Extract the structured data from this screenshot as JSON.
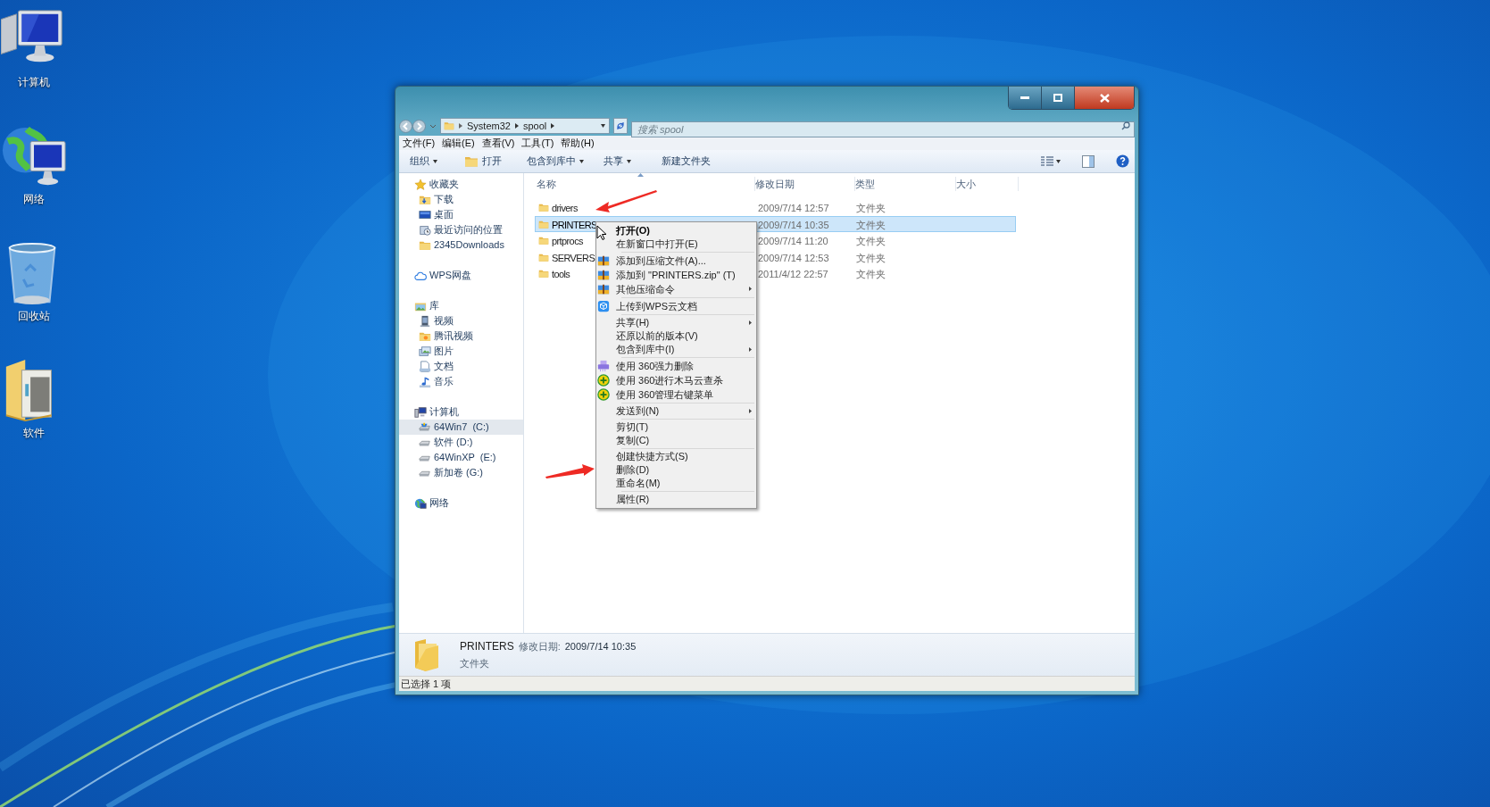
{
  "desktop": {
    "icons": [
      {
        "label": "计算机"
      },
      {
        "label": "网络"
      },
      {
        "label": "回收站"
      },
      {
        "label": "软件"
      }
    ]
  },
  "window": {
    "address": {
      "segments": [
        "System32",
        "spool"
      ]
    },
    "search": {
      "placeholder": "搜索 spool"
    },
    "menu_bar": [
      "文件(F)",
      "编辑(E)",
      "查看(V)",
      "工具(T)",
      "帮助(H)"
    ],
    "toolbar": [
      {
        "label": "组织",
        "dropdown": true
      },
      {
        "label": "打开",
        "dropdown": false
      },
      {
        "label": "包含到库中",
        "dropdown": true
      },
      {
        "label": "共享",
        "dropdown": true
      },
      {
        "label": "新建文件夹",
        "dropdown": false
      }
    ],
    "sidebar": [
      {
        "label": "收藏夹",
        "selected": false,
        "children": [
          {
            "label": "下载",
            "selected": false
          },
          {
            "label": "桌面",
            "selected": false
          },
          {
            "label": "最近访问的位置",
            "selected": false
          },
          {
            "label": "2345Downloads",
            "selected": false
          }
        ]
      },
      {
        "label": "WPS网盘",
        "selected": false
      },
      {
        "label": "库",
        "selected": false,
        "children": [
          {
            "label": "视频",
            "selected": false
          },
          {
            "label": "腾讯视频",
            "selected": false
          },
          {
            "label": "图片",
            "selected": false
          },
          {
            "label": "文档",
            "selected": false
          },
          {
            "label": "音乐",
            "selected": false
          }
        ]
      },
      {
        "label": "计算机",
        "selected": false,
        "children": [
          {
            "label": "64Win7  (C:)",
            "selected": true
          },
          {
            "label": "软件 (D:)",
            "selected": false
          },
          {
            "label": "64WinXP  (E:)",
            "selected": false
          },
          {
            "label": "新加卷 (G:)",
            "selected": false
          }
        ]
      },
      {
        "label": "网络",
        "selected": false
      }
    ],
    "files": {
      "columns": [
        "名称",
        "修改日期",
        "类型",
        "大小"
      ],
      "rows": [
        {
          "name": "drivers",
          "date": "2009/7/14 12:57",
          "type": "文件夹",
          "selected": false
        },
        {
          "name": "PRINTERS",
          "date": "2009/7/14 10:35",
          "type": "文件夹",
          "selected": true
        },
        {
          "name": "prtprocs",
          "date": "2009/7/14 11:20",
          "type": "文件夹",
          "selected": false
        },
        {
          "name": "SERVERS",
          "date": "2009/7/14 12:53",
          "type": "文件夹",
          "selected": false
        },
        {
          "name": "tools",
          "date": "2011/4/12 22:57",
          "type": "文件夹",
          "selected": false
        }
      ]
    },
    "context_menu": {
      "groups": [
        [
          {
            "label": "打开(O)",
            "default": true,
            "submenu": false
          },
          {
            "label": "在新窗口中打开(E)",
            "default": false,
            "submenu": false
          }
        ],
        [
          {
            "label": "添加到压缩文件(A)...",
            "default": false,
            "submenu": false
          },
          {
            "label": "添加到 \"PRINTERS.zip\" (T)",
            "default": false,
            "submenu": false
          },
          {
            "label": "其他压缩命令",
            "default": false,
            "submenu": true
          }
        ],
        [
          {
            "label": "上传到WPS云文档",
            "default": false,
            "submenu": false
          }
        ],
        [
          {
            "label": "共享(H)",
            "default": false,
            "submenu": true
          },
          {
            "label": "还原以前的版本(V)",
            "default": false,
            "submenu": false
          },
          {
            "label": "包含到库中(I)",
            "default": false,
            "submenu": true
          }
        ],
        [
          {
            "label": "使用 360强力删除",
            "default": false,
            "submenu": false
          },
          {
            "label": "使用 360进行木马云查杀",
            "default": false,
            "submenu": false
          },
          {
            "label": "使用 360管理右键菜单",
            "default": false,
            "submenu": false
          }
        ],
        [
          {
            "label": "发送到(N)",
            "default": false,
            "submenu": true
          }
        ],
        [
          {
            "label": "剪切(T)",
            "default": false,
            "submenu": false
          },
          {
            "label": "复制(C)",
            "default": false,
            "submenu": false
          }
        ],
        [
          {
            "label": "创建快捷方式(S)",
            "default": false,
            "submenu": false
          },
          {
            "label": "删除(D)",
            "default": false,
            "submenu": false
          },
          {
            "label": "重命名(M)",
            "default": false,
            "submenu": false
          }
        ],
        [
          {
            "label": "属性(R)",
            "default": false,
            "submenu": false
          }
        ]
      ]
    },
    "details": {
      "name": "PRINTERS",
      "date_label": "修改日期:",
      "date": "2009/7/14 10:35",
      "type": "文件夹"
    },
    "status_bar": "已选择 1 项"
  }
}
